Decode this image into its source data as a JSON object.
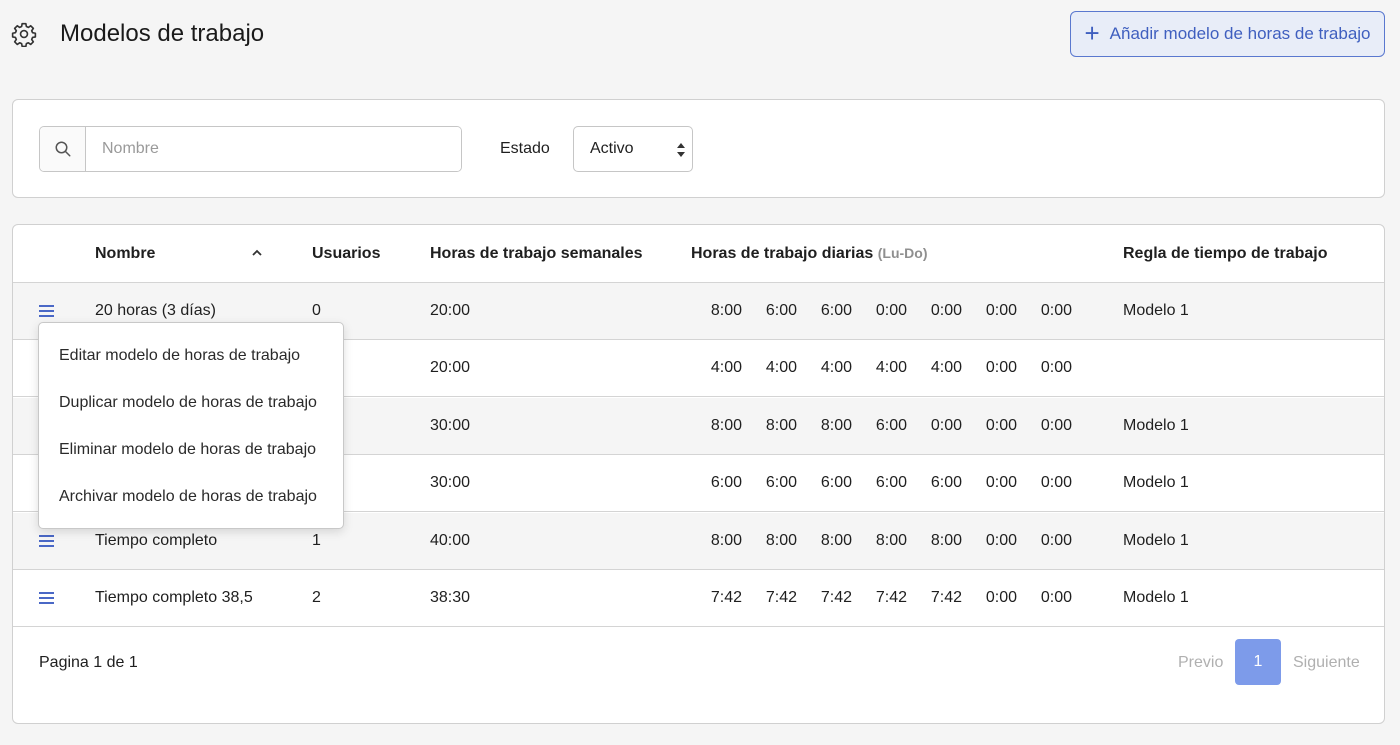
{
  "header": {
    "title": "Modelos de trabajo",
    "add_button_label": "Añadir modelo de horas de trabajo"
  },
  "filters": {
    "search_placeholder": "Nombre",
    "estado_label": "Estado",
    "estado_value": "Activo"
  },
  "table": {
    "columns": {
      "nombre": "Nombre",
      "usuarios": "Usuarios",
      "semanales": "Horas de trabajo semanales",
      "diarias": "Horas de trabajo diarias",
      "diarias_sub": "(Lu-Do)",
      "regla": "Regla de tiempo de trabajo"
    },
    "rows": [
      {
        "name": "20 horas (3 días)",
        "users": "0",
        "weekly": "20:00",
        "days": [
          "8:00",
          "6:00",
          "6:00",
          "0:00",
          "0:00",
          "0:00",
          "0:00"
        ],
        "rule": "Modelo 1"
      },
      {
        "name": "",
        "users": "",
        "weekly": "20:00",
        "days": [
          "4:00",
          "4:00",
          "4:00",
          "4:00",
          "4:00",
          "0:00",
          "0:00"
        ],
        "rule": ""
      },
      {
        "name": "",
        "users": "",
        "weekly": "30:00",
        "days": [
          "8:00",
          "8:00",
          "8:00",
          "6:00",
          "0:00",
          "0:00",
          "0:00"
        ],
        "rule": "Modelo 1"
      },
      {
        "name": "",
        "users": "",
        "weekly": "30:00",
        "days": [
          "6:00",
          "6:00",
          "6:00",
          "6:00",
          "6:00",
          "0:00",
          "0:00"
        ],
        "rule": "Modelo 1"
      },
      {
        "name": "Tiempo completo",
        "users": "1",
        "weekly": "40:00",
        "days": [
          "8:00",
          "8:00",
          "8:00",
          "8:00",
          "8:00",
          "0:00",
          "0:00"
        ],
        "rule": "Modelo 1"
      },
      {
        "name": "Tiempo completo 38,5",
        "users": "2",
        "weekly": "38:30",
        "days": [
          "7:42",
          "7:42",
          "7:42",
          "7:42",
          "7:42",
          "0:00",
          "0:00"
        ],
        "rule": "Modelo 1"
      }
    ]
  },
  "pagination": {
    "info": "Pagina 1 de 1",
    "prev": "Previo",
    "current": "1",
    "next": "Siguiente"
  },
  "context_menu": {
    "items": [
      "Editar modelo de horas de trabajo",
      "Duplicar modelo de horas de trabajo",
      "Eliminar modelo de horas de trabajo",
      "Archivar modelo de horas de trabajo"
    ]
  },
  "colors": {
    "accent": "#3f5fbf",
    "page_active": "#7d9bea",
    "menu_icon": "#4a68c6"
  }
}
